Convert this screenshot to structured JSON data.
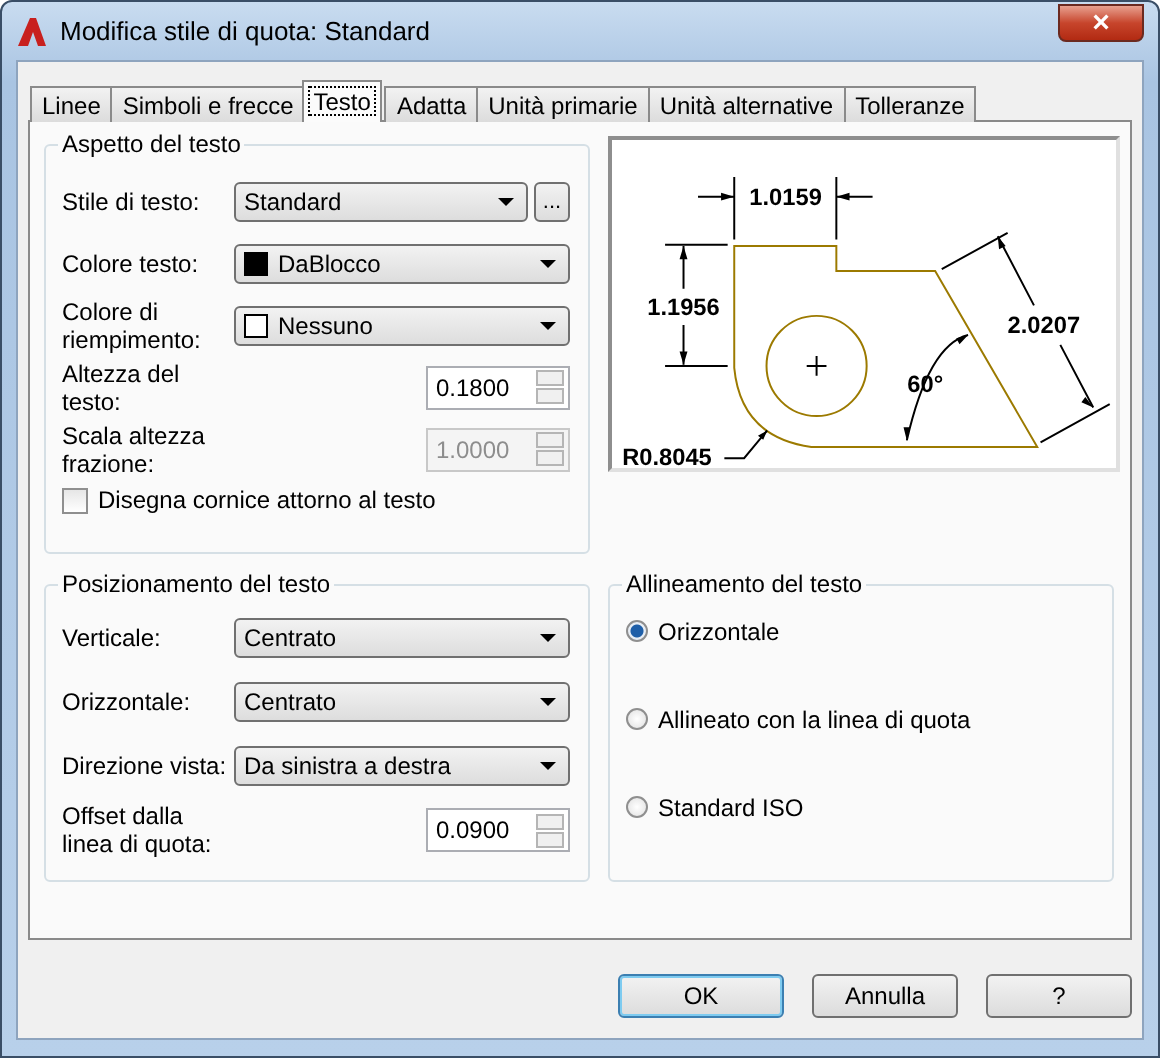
{
  "window": {
    "title": "Modifica stile di quota: Standard",
    "close": "×"
  },
  "tabs": [
    {
      "label": "Linee",
      "selected": false
    },
    {
      "label": "Simboli e frecce",
      "selected": false
    },
    {
      "label": "Testo",
      "selected": true
    },
    {
      "label": "Adatta",
      "selected": false
    },
    {
      "label": "Unità primarie",
      "selected": false
    },
    {
      "label": "Unità alternative",
      "selected": false
    },
    {
      "label": "Tolleranze",
      "selected": false
    }
  ],
  "text_appearance": {
    "title": "Aspetto del testo",
    "fields": [
      {
        "label": "Stile di testo:",
        "kind": "dropdown",
        "value": "Standard",
        "button": "..."
      },
      {
        "label": "Colore testo:",
        "kind": "dropdown",
        "value": "DaBlocco",
        "color": "#000000"
      },
      {
        "label": "Colore di riempimento:",
        "kind": "dropdown",
        "value": "Nessuno",
        "color": "#ffffff"
      },
      {
        "label": "Altezza del testo:",
        "kind": "spinner",
        "value": "0.1800",
        "disabled": false
      },
      {
        "label": "Scala altezza frazione:",
        "kind": "spinner",
        "value": "1.0000",
        "disabled": true
      }
    ],
    "checkbox": {
      "label": "Disegna cornice attorno al testo",
      "checked": false
    }
  },
  "preview": {
    "labels": [
      "1.0159",
      "1.1956",
      "2.0207",
      "60°",
      "R0.8045"
    ]
  },
  "text_placement": {
    "title": "Posizionamento del testo",
    "fields": [
      {
        "label": "Verticale:",
        "kind": "dropdown",
        "value": "Centrato"
      },
      {
        "label": "Orizzontale:",
        "kind": "dropdown",
        "value": "Centrato"
      },
      {
        "label": "Direzione vista:",
        "kind": "dropdown",
        "value": "Da sinistra a destra"
      },
      {
        "label": "Offset dalla linea di quota:",
        "kind": "spinner",
        "value": "0.0900",
        "disabled": false
      }
    ]
  },
  "text_alignment": {
    "title": "Allineamento del testo",
    "options": [
      {
        "label": "Orizzontale",
        "selected": true
      },
      {
        "label": "Allineato con la linea di quota",
        "selected": false
      },
      {
        "label": "Standard ISO",
        "selected": false
      }
    ]
  },
  "buttons": [
    {
      "label": "OK",
      "default": true
    },
    {
      "label": "Annulla",
      "default": false
    },
    {
      "label": "?",
      "default": false
    }
  ]
}
